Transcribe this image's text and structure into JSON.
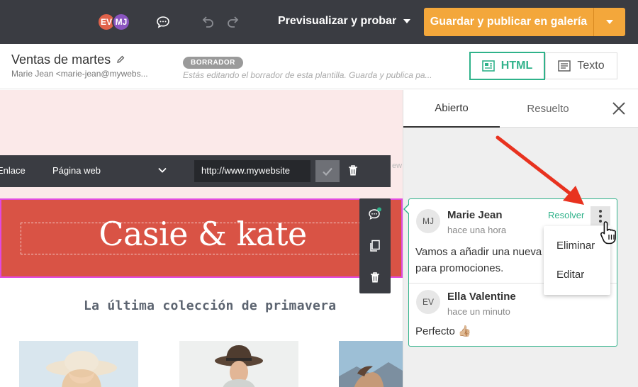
{
  "topbar": {
    "avatars": [
      {
        "initials": "EV",
        "color": "#e0624a"
      },
      {
        "initials": "MJ",
        "color": "#8a55c0"
      }
    ],
    "preview_label": "Previsualizar y probar",
    "publish_label": "Guardar y publicar en galería",
    "accent_color": "#f3a73b"
  },
  "header": {
    "title": "Ventas de martes",
    "sender": "Marie Jean <marie-jean@mywebs...",
    "status_badge": "BORRADOR",
    "hint": "Estás editando el borrador de esta plantilla. Guarda y publica pa...",
    "mode_html": "HTML",
    "mode_text": "Texto",
    "active_color": "#2fb28a"
  },
  "link_toolbar": {
    "link_type_label": "Enlace",
    "link_target": "Página web",
    "url_value": "http://www.mywebsite"
  },
  "canvas": {
    "ghost_text": "ew",
    "logo_text": "Casie & kate",
    "subheading": "La última colección de primavera",
    "banner_color": "#d95345"
  },
  "comments": {
    "tabs": [
      "Abierto",
      "Resuelto"
    ],
    "active_tab": "Abierto",
    "resolve_label": "Resolver",
    "thread": [
      {
        "initials": "MJ",
        "author": "Marie Jean",
        "time": "hace una hora",
        "text": "Vamos a añadir una nueva\npara promociones."
      },
      {
        "initials": "EV",
        "author": "Ella Valentine",
        "time": "hace un minuto",
        "text": "Perfecto 👍🏼"
      }
    ],
    "menu": [
      "Eliminar",
      "Editar"
    ]
  }
}
